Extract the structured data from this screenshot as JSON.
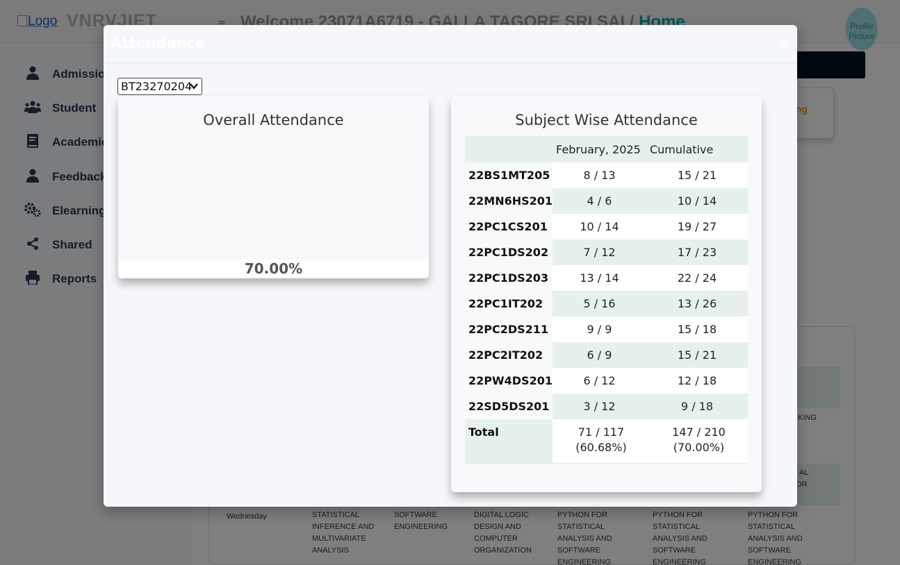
{
  "header": {
    "logo_alt": "Logo",
    "brand": "VNRVJIET",
    "hamburger": "≡",
    "welcome": "Welcome 23071A6719 - GALLA TAGORE SRI SAI",
    "separator": "/",
    "home": "Home",
    "avatar_alt": "Profile Picture"
  },
  "sidebar": {
    "items": [
      {
        "label": "Admission",
        "icon": "user-icon"
      },
      {
        "label": "Student",
        "icon": "users-icon"
      },
      {
        "label": "Academic",
        "icon": "book-icon"
      },
      {
        "label": "Feedback",
        "icon": "user-icon"
      },
      {
        "label": "Elearning",
        "icon": "gears-icon"
      },
      {
        "label": "Shared",
        "icon": "share-icon"
      },
      {
        "label": "Reports",
        "icon": "print-icon"
      }
    ]
  },
  "background": {
    "pending_fragment": "ing",
    "frag1": "KING",
    "frag2": "AL",
    "frag3": "S FOR",
    "timetable_day": "Wednesday",
    "cells": [
      "STATISTICAL INFERENCE AND MULTIVARIATE ANALYSIS",
      "SOFTWARE ENGINEERING",
      "DIGITAL LOGIC DESIGN AND COMPUTER ORGANIZATION",
      "PYTHON FOR STATISTICAL ANALYSIS AND SOFTWARE ENGINEERING LABORATORY",
      "PYTHON FOR STATISTICAL ANALYSIS AND SOFTWARE ENGINEERING LABORATORY",
      "PYTHON FOR STATISTICAL ANALYSIS AND SOFTWARE ENGINEERING LABORATORY"
    ]
  },
  "modal": {
    "title": "Attendance",
    "close": "×",
    "select_value": "BT23270204",
    "overall": {
      "title": "Overall Attendance",
      "percentage": "70.00%"
    },
    "subject": {
      "title": "Subject Wise Attendance",
      "headers": [
        "",
        "February, 2025",
        "Cumulative"
      ],
      "rows": [
        {
          "code": "22BS1MT205",
          "month": "8 / 13",
          "cumulative": "15 / 21"
        },
        {
          "code": "22MN6HS201",
          "month": "4 / 6",
          "cumulative": "10 / 14"
        },
        {
          "code": "22PC1CS201",
          "month": "10 / 14",
          "cumulative": "19 / 27"
        },
        {
          "code": "22PC1DS202",
          "month": "7 / 12",
          "cumulative": "17 / 23"
        },
        {
          "code": "22PC1DS203",
          "month": "13 / 14",
          "cumulative": "22 / 24"
        },
        {
          "code": "22PC1IT202",
          "month": "5 / 16",
          "cumulative": "13 / 26"
        },
        {
          "code": "22PC2DS211",
          "month": "9 / 9",
          "cumulative": "15 / 18"
        },
        {
          "code": "22PC2IT202",
          "month": "6 / 9",
          "cumulative": "15 / 21"
        },
        {
          "code": "22PW4DS201",
          "month": "6 / 12",
          "cumulative": "12 / 18"
        },
        {
          "code": "22SD5DS201",
          "month": "3 / 12",
          "cumulative": "9 / 18"
        }
      ],
      "total": {
        "label": "Total",
        "month_line1": "71 / 117",
        "month_line2": "(60.68%)",
        "cumulative_line1": "147 / 210",
        "cumulative_line2": "(70.00%)"
      }
    }
  },
  "colors": {
    "accent": "#18a0a8",
    "row_stripe": "#e6f1ee",
    "sidebar_text": "#27384f"
  }
}
